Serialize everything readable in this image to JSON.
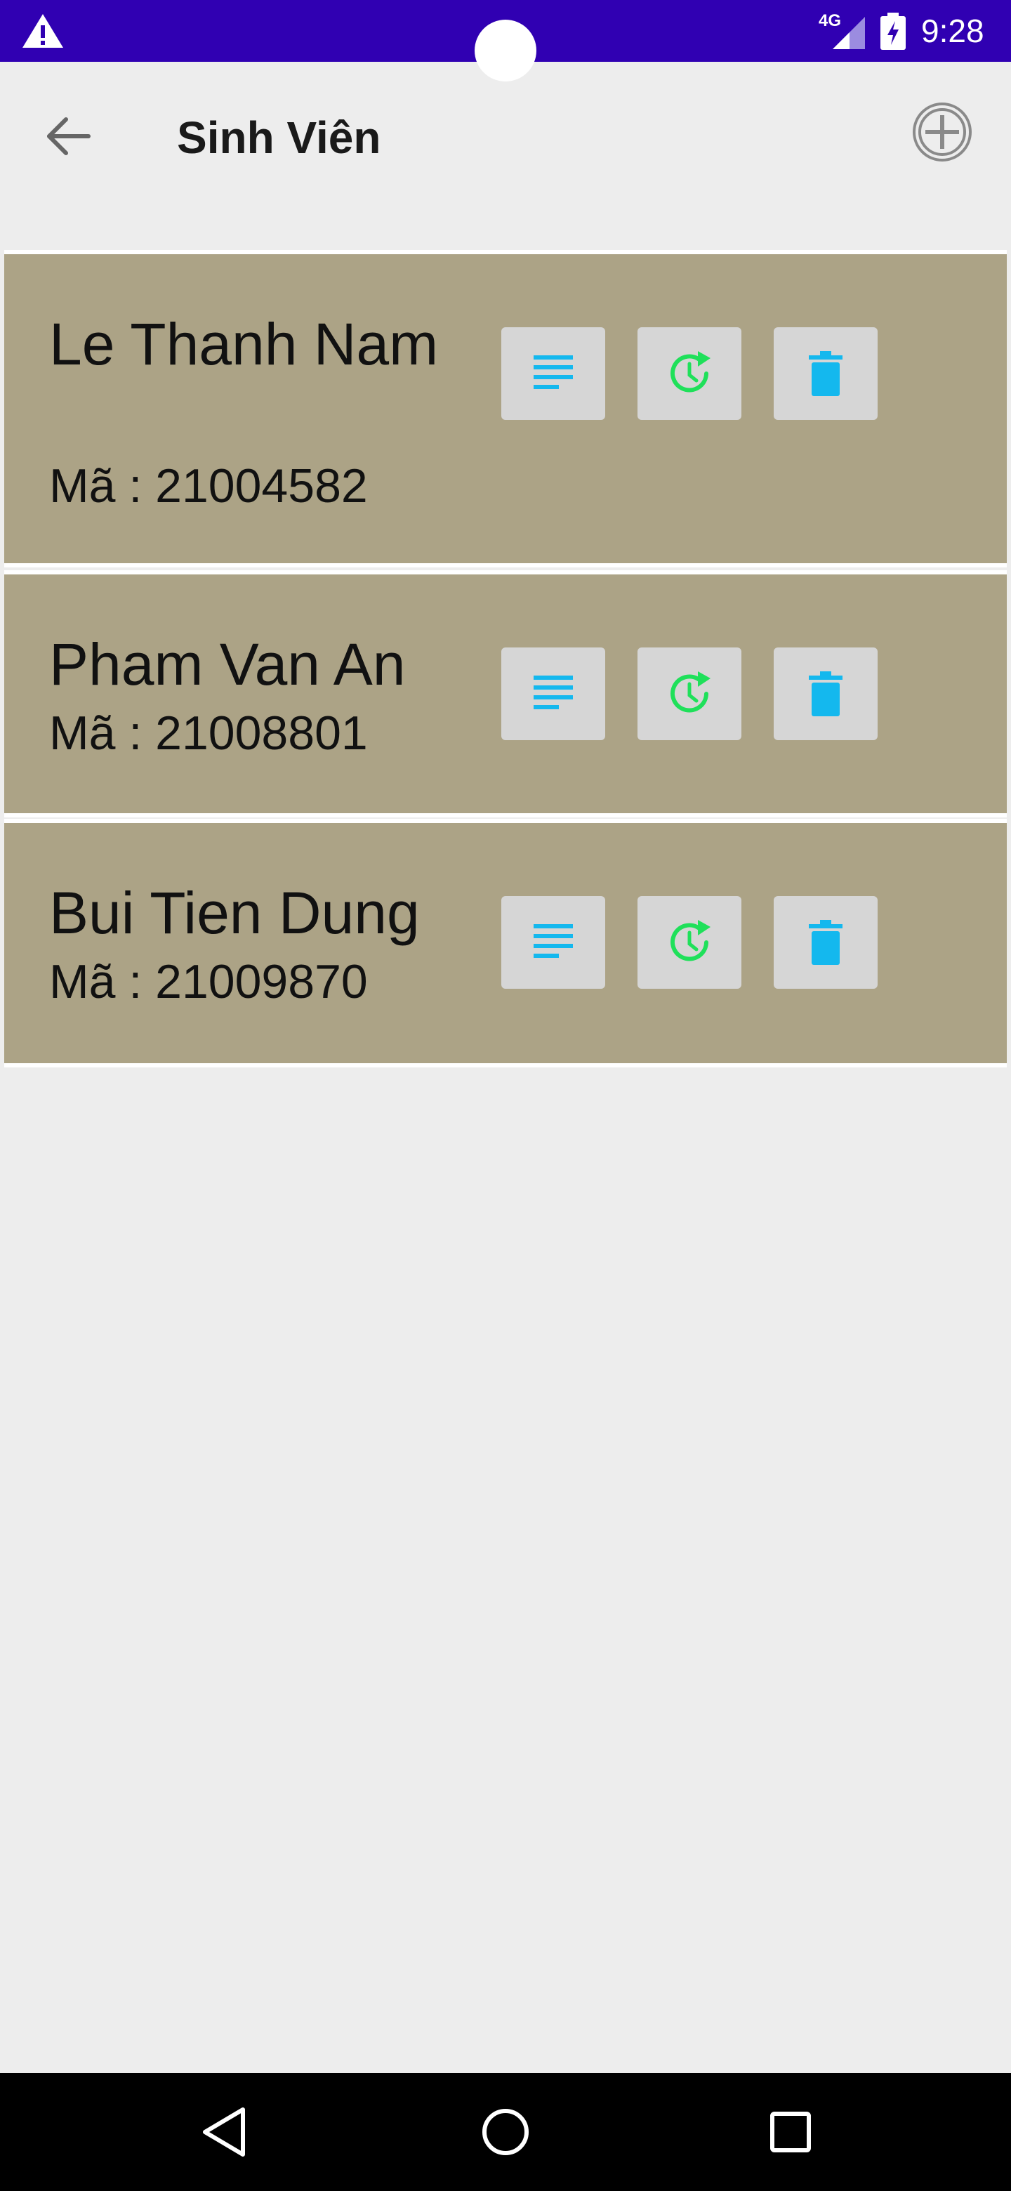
{
  "status_bar": {
    "network_label": "4G",
    "time": "9:28",
    "icons": [
      "warning-icon",
      "signal-icon",
      "battery-charging-icon"
    ]
  },
  "app_bar": {
    "title": "Sinh Viên",
    "back_icon": "arrow-left-icon",
    "add_icon": "circle-plus-icon"
  },
  "students": [
    {
      "name": "Le Thanh Nam",
      "code_label": "Mã",
      "code": "21004582"
    },
    {
      "name": "Pham Van An",
      "code_label": "Mã",
      "code": "21008801"
    },
    {
      "name": "Bui Tien Dung",
      "code_label": "Mã",
      "code": "21009870"
    }
  ],
  "row_actions": {
    "details_icon": "list-lines-icon",
    "history_icon": "clock-refresh-icon",
    "delete_icon": "trash-icon"
  },
  "colors": {
    "status_bar": "#3000b2",
    "background": "#ededed",
    "card": "#aca386",
    "button": "#d6d6d6",
    "blue_icon": "#14b8ee",
    "green_icon": "#1fe05a",
    "nav_bar": "#000000"
  },
  "nav_bar": {
    "icons": [
      "nav-back-icon",
      "nav-home-icon",
      "nav-recents-icon"
    ]
  }
}
